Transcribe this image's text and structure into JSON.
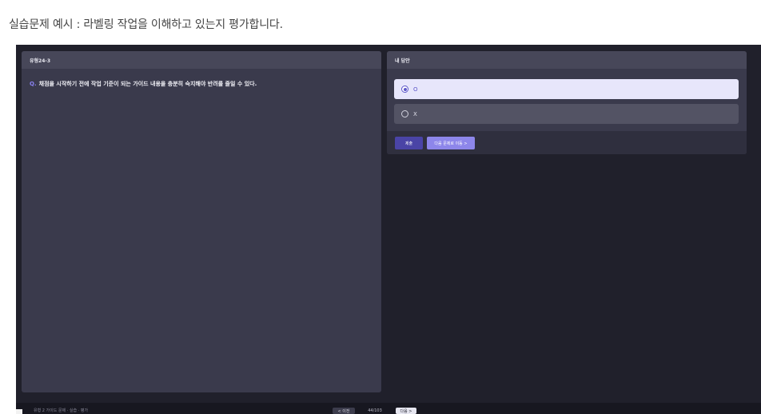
{
  "caption": "실습문제 예시 : 라벨링 작업을 이해하고 있는지 평가합니다.",
  "question_panel": {
    "title": "유형24-3",
    "question_mark": "Q.",
    "question_text": "채점을 시작하기 전에 작업 기준이 되는 가이드 내용을 충분히 숙지해야 반려를 줄일 수 있다."
  },
  "answer_panel": {
    "title": "내 답안",
    "options": [
      {
        "label": "O",
        "selected": true
      },
      {
        "label": "X",
        "selected": false
      }
    ],
    "submit_label": "제출",
    "next_question_label": "다음 문제로 이동 >"
  },
  "bottom_bar": {
    "path_text": "유형 2 가이드 문제 · 실습 · 평가",
    "prev_label": "< 이전",
    "page_label": "44/103",
    "next_label": "다음 >"
  },
  "colors": {
    "accent": "#5d57c9",
    "accent_light": "#8d86ea",
    "panel_bg": "#3a3a4c",
    "app_bg": "#20202b"
  }
}
